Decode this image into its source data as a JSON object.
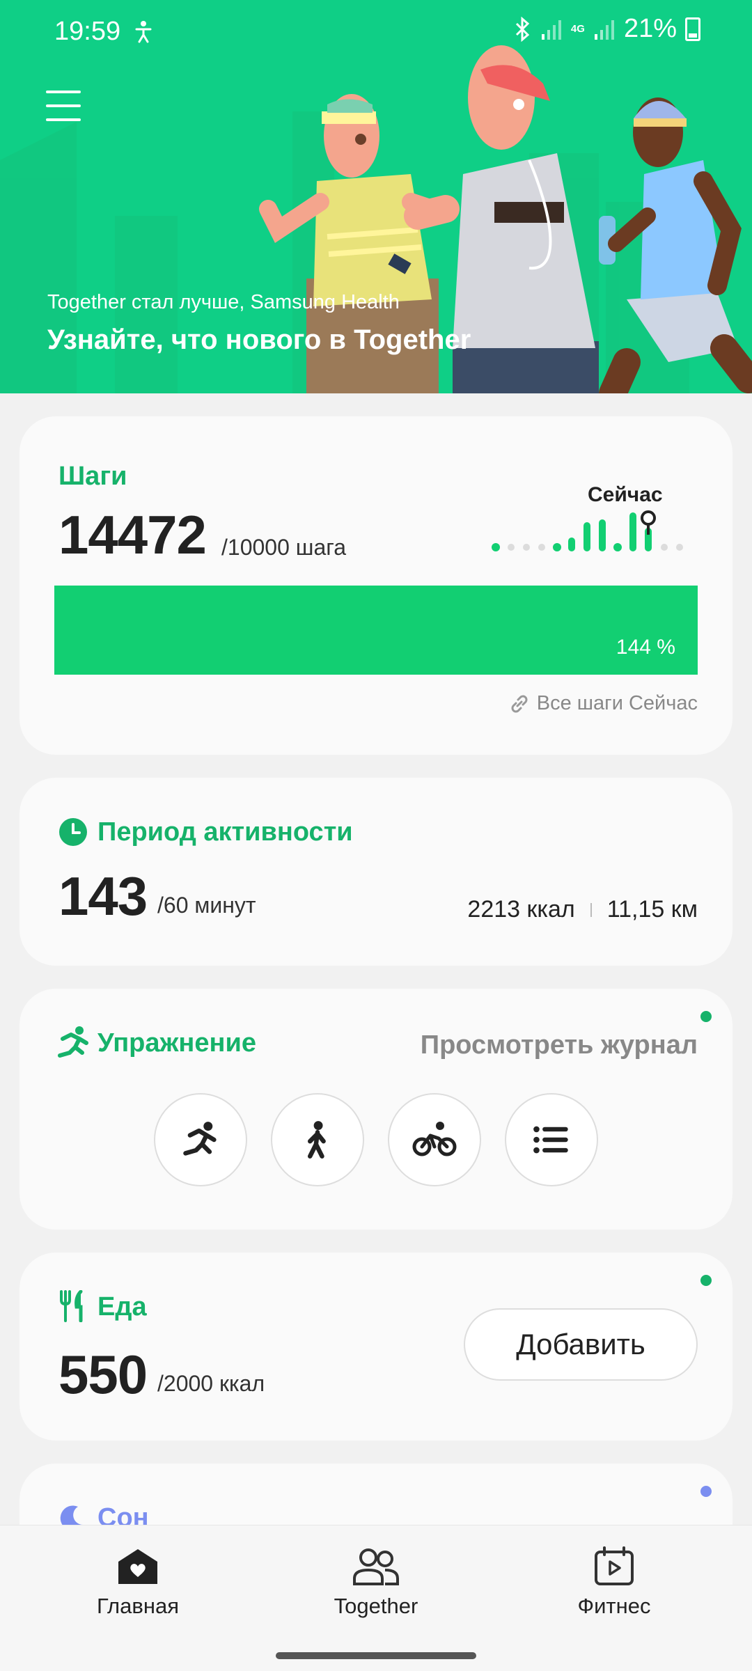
{
  "status_bar": {
    "time": "19:59",
    "network": "4G",
    "battery": "21%"
  },
  "banner": {
    "subtitle": "Together стал лучше, Samsung Health",
    "title": "Узнайте, что нового в Together"
  },
  "steps": {
    "title": "Шаги",
    "count": "14472",
    "goal": "/10000 шага",
    "now_label": "Сейчас",
    "percent": "144 %",
    "progress_fraction": 1.0,
    "link": "Все шаги Сейчас"
  },
  "activity": {
    "title": "Период активности",
    "minutes": "143",
    "goal": "/60 минут",
    "kcal": "2213 ккал",
    "distance": "11,15 км"
  },
  "exercise": {
    "title": "Упражнение",
    "journal": "Просмотреть журнал",
    "buttons": [
      "running-icon",
      "walking-icon",
      "cycling-icon",
      "list-icon"
    ]
  },
  "food": {
    "title": "Еда",
    "kcal": "550",
    "goal": "/2000 ккал",
    "add": "Добавить"
  },
  "sleep": {
    "title": "Сон"
  },
  "nav": {
    "home": "Главная",
    "together": "Together",
    "fitness": "Фитнес"
  },
  "colors": {
    "accent": "#16b26a",
    "banner": "#0fcf86",
    "sleep": "#7b8ef0",
    "bar": "#12cf72"
  }
}
